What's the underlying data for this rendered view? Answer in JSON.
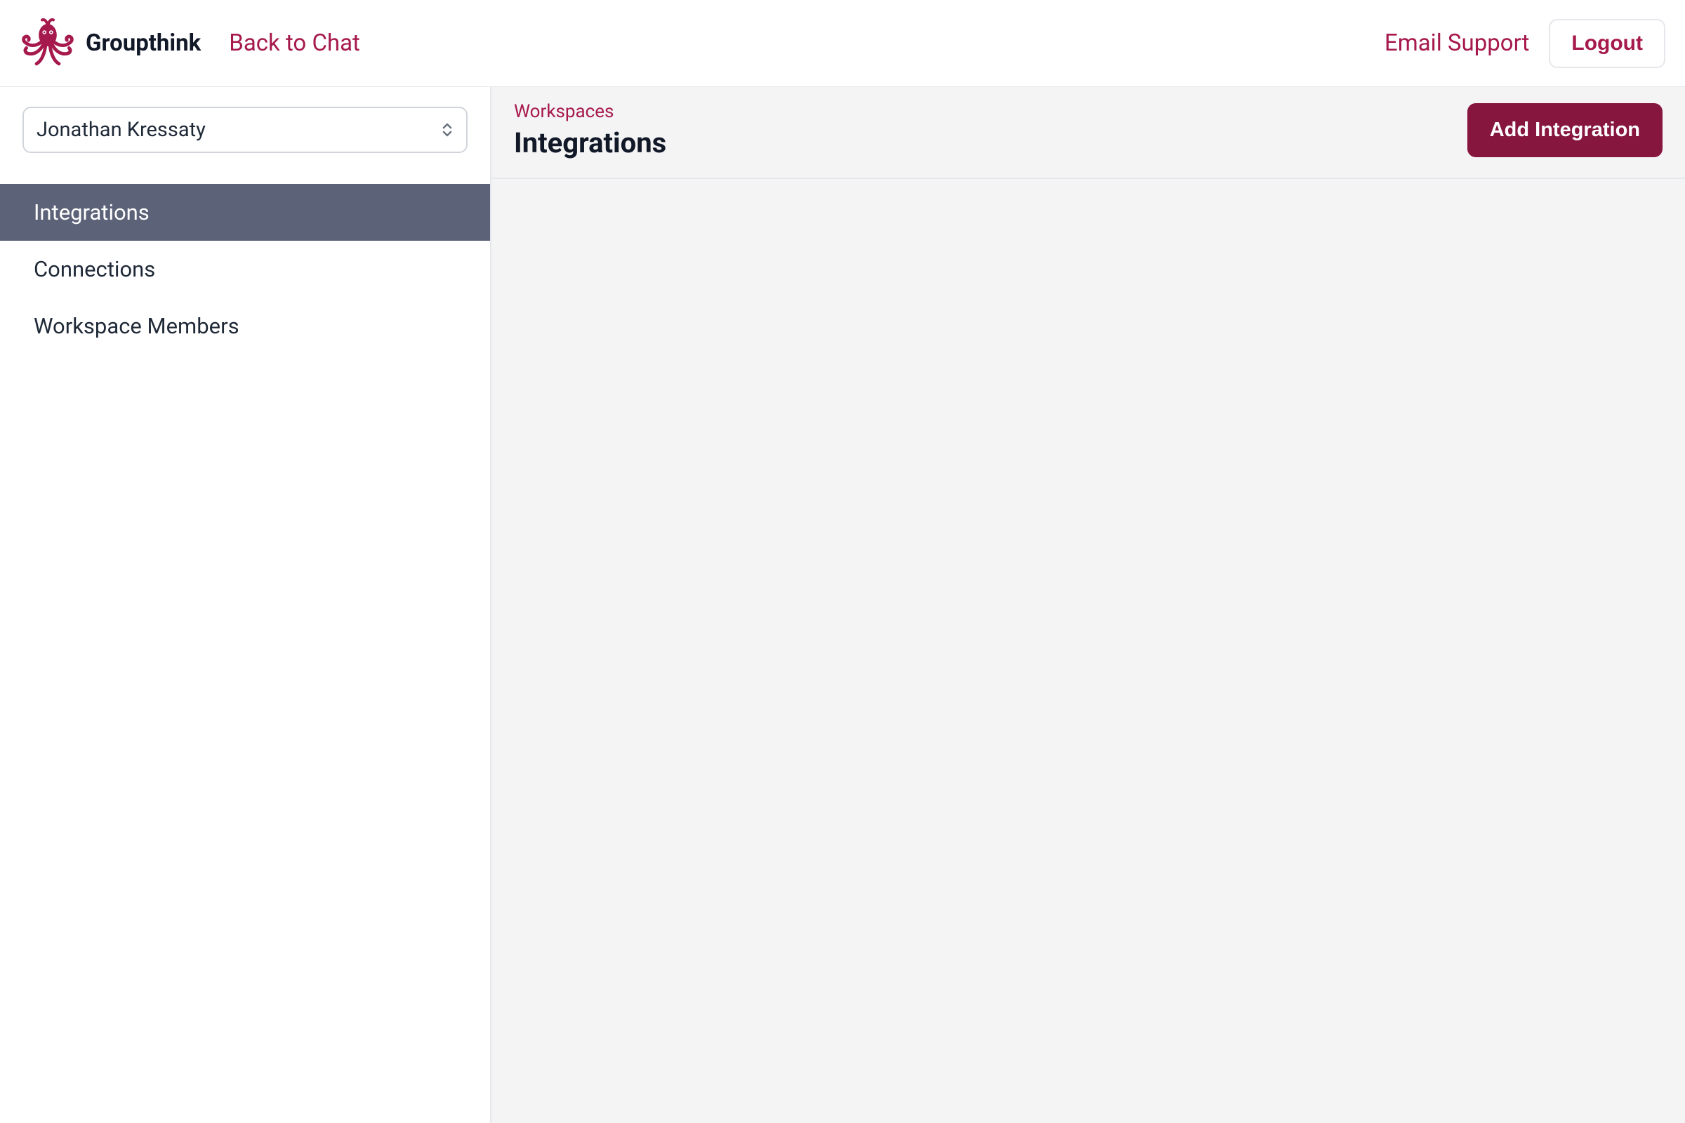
{
  "header": {
    "brand": "Groupthink",
    "back_link": "Back to Chat",
    "support_link": "Email Support",
    "logout": "Logout"
  },
  "sidebar": {
    "workspace_selected": "Jonathan Kressaty",
    "nav": [
      {
        "label": "Integrations",
        "active": true
      },
      {
        "label": "Connections",
        "active": false
      },
      {
        "label": "Workspace Members",
        "active": false
      }
    ]
  },
  "main": {
    "breadcrumb": "Workspaces",
    "title": "Integrations",
    "primary_action": "Add Integration"
  },
  "colors": {
    "accent": "#a6194c",
    "accent_dark": "#87163f",
    "nav_active_bg": "#5c6278"
  }
}
